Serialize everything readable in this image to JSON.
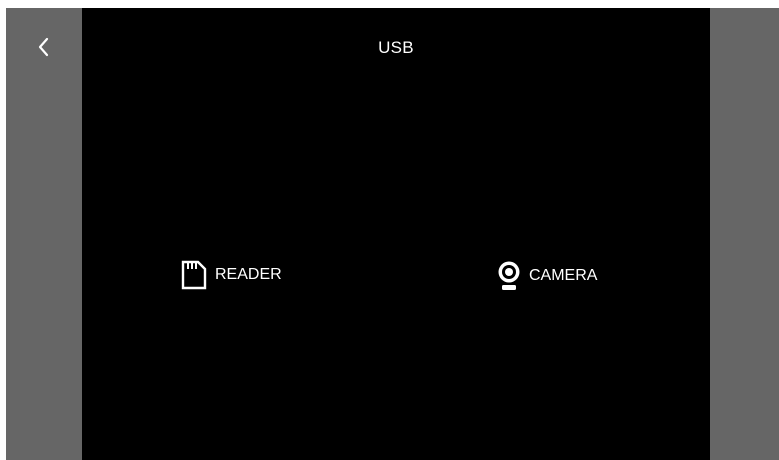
{
  "header": {
    "title": "USB",
    "back_icon": "chevron-left-icon"
  },
  "options": [
    {
      "label": "READER",
      "icon": "sd-card-icon"
    },
    {
      "label": "CAMERA",
      "icon": "webcam-icon"
    }
  ],
  "colors": {
    "screen_bg": "#000000",
    "side_bezel": "#666666",
    "foreground": "#ffffff"
  }
}
